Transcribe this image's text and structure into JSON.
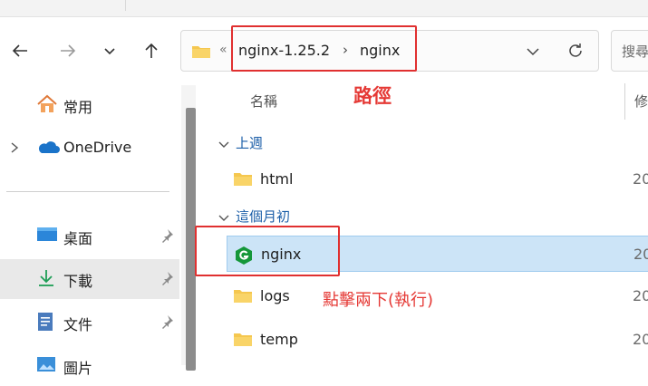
{
  "nav": {
    "back_icon": "arrow-left-icon",
    "forward_icon": "arrow-right-icon",
    "recent_icon": "chevron-down-icon",
    "up_icon": "arrow-up-icon"
  },
  "address": {
    "overflow": "«",
    "crumbs": [
      "nginx-1.25.2",
      "nginx"
    ],
    "separator": "›",
    "folder_color": "#f5c74f"
  },
  "search": {
    "placeholder": "搜尋"
  },
  "sidebar": {
    "items": [
      {
        "label": "常用",
        "icon": "home-icon"
      },
      {
        "label": "OneDrive",
        "icon": "cloud-icon"
      },
      {
        "label": "桌面",
        "icon": "desktop-icon",
        "pinned": true
      },
      {
        "label": "下載",
        "icon": "download-icon",
        "pinned": true,
        "selected": true
      },
      {
        "label": "文件",
        "icon": "document-icon",
        "pinned": true
      },
      {
        "label": "圖片",
        "icon": "pictures-icon"
      }
    ]
  },
  "list": {
    "columns": {
      "name": "名稱",
      "modified": "修"
    },
    "groups": [
      {
        "label": "上週",
        "rows": [
          {
            "name": "html",
            "date": "20",
            "icon": "folder-icon"
          }
        ]
      },
      {
        "label": "這個月初",
        "rows": [
          {
            "name": "nginx",
            "date": "20",
            "icon": "nginx-app-icon",
            "selected": true
          },
          {
            "name": "logs",
            "date": "20",
            "icon": "folder-icon"
          },
          {
            "name": "temp",
            "date": "20",
            "icon": "folder-icon"
          }
        ]
      }
    ]
  },
  "annotations": {
    "path_label": "路徑",
    "click_label": "點擊兩下(執行)",
    "color": "#e53935"
  },
  "colors": {
    "accent": "#1b5ea8",
    "selection": "#cce4f7",
    "highlight": "#e03030"
  }
}
